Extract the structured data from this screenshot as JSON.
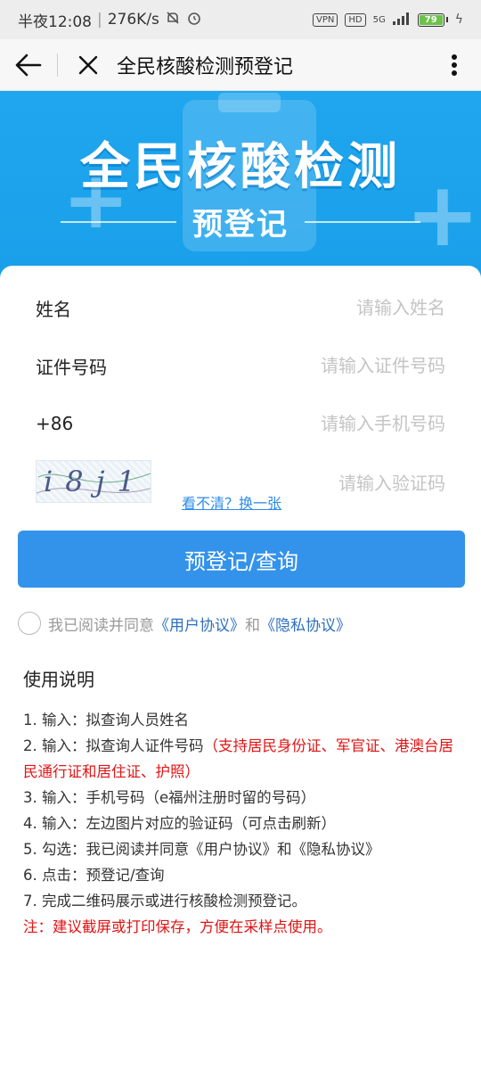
{
  "status_bar": {
    "time": "半夜12:08",
    "speed": "276K/s",
    "vpn": "VPN",
    "hd": "HD",
    "network": "5G",
    "battery": "79"
  },
  "nav": {
    "title": "全民核酸检测预登记"
  },
  "banner": {
    "title": "全民核酸检测",
    "subtitle": "预登记"
  },
  "form": {
    "name_label": "姓名",
    "name_placeholder": "请输入姓名",
    "id_label": "证件号码",
    "id_placeholder": "请输入证件号码",
    "phone_prefix": "+86",
    "phone_placeholder": "请输入手机号码",
    "captcha_text": "i8j1",
    "refresh_link": "看不清？换一张",
    "captcha_placeholder": "请输入验证码",
    "submit_label": "预登记/查询"
  },
  "agreement": {
    "prefix": "我已阅读并同意",
    "user_agreement": "《用户协议》",
    "and": "和",
    "privacy": "《隐私协议》"
  },
  "instructions": {
    "title": "使用说明",
    "item1": "1. 输入：拟查询人员姓名",
    "item2_prefix": "2. 输入：拟查询人证件号码",
    "item2_red": "（支持居民身份证、军官证、港澳台居民通行证和居住证、护照）",
    "item3": "3. 输入：手机号码（e福州注册时留的号码）",
    "item4": "4. 输入：左边图片对应的验证码（可点击刷新）",
    "item5": "5. 勾选：我已阅读并同意《用户协议》和《隐私协议》",
    "item6": "6. 点击：预登记/查询",
    "item7": "7. 完成二维码展示或进行核酸检测预登记。",
    "note_prefix": "注：",
    "note_red": "建议截屏或打印保存，方便在采样点使用。"
  },
  "colors": {
    "banner_blue": "#1fa6ee",
    "button_blue": "#3392ea",
    "link_blue": "#2d6fbf",
    "warning_red": "#e01414"
  }
}
